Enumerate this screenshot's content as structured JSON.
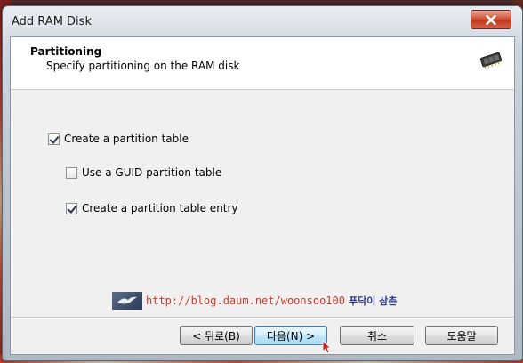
{
  "window": {
    "title": "Add RAM Disk"
  },
  "header": {
    "title": "Partitioning",
    "subtitle": "Specify partitioning on the RAM disk",
    "icon": "memory-chip-icon"
  },
  "options": [
    {
      "label": "Create a partition table",
      "checked": true
    },
    {
      "label": "Use a GUID partition table",
      "checked": false
    },
    {
      "label": "Create a partition table entry",
      "checked": true
    }
  ],
  "watermark": {
    "url": "http://blog.daum.net/woonsoo100",
    "tag": "푸닥이 삼촌"
  },
  "buttons": {
    "back": "< 뒤로(B)",
    "next": "다음(N) >",
    "cancel": "취소",
    "help": "도움말"
  },
  "colors": {
    "close_button": "#c1371c",
    "default_button": "#bee6fd",
    "watermark_url": "#c63b2b"
  }
}
